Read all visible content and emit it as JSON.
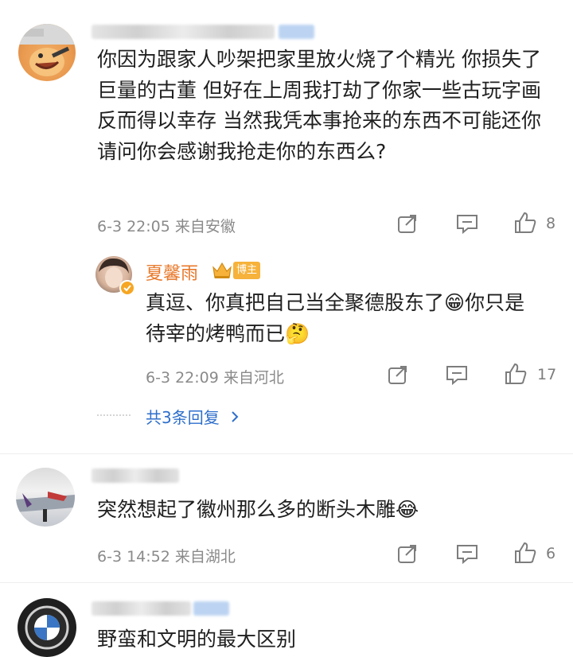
{
  "comments": [
    {
      "text": "你因为跟家人吵架把家里放火烧了个精光 你损失了巨量的古董 但好在上周我打劫了你家一些古玩字画反而得以幸存 当然我凭本事抢来的东西不可能还你 请问你会感谢我抢走你的东西么?",
      "time": "6-3 22:05",
      "location": "来自安徽",
      "likes": "8"
    },
    {
      "text": "突然想起了徽州那么多的断头木雕",
      "emoji": "😂",
      "time": "6-3 14:52",
      "location": "来自湖北",
      "likes": "6"
    },
    {
      "text": "野蛮和文明的最大区别"
    }
  ],
  "reply": {
    "name": "夏馨雨",
    "badge": "博主",
    "text": "真逗、你真把自己当全聚德股东了",
    "emoji1": "😁",
    "text2": "你只是待宰的烤鸭而已",
    "emoji2": "🤔",
    "time": "6-3 22:09",
    "location": "来自河北",
    "likes": "17"
  },
  "more_replies": "共3条回复",
  "icons": [
    "share-icon",
    "comment-icon",
    "like-icon",
    "chevron-right-icon",
    "crown-icon",
    "verified-icon"
  ],
  "colors": {
    "accent": "#2e6fcb",
    "name": "#e8792b",
    "meta": "#8a8a8a",
    "badge_bg": "#f6b23b"
  }
}
